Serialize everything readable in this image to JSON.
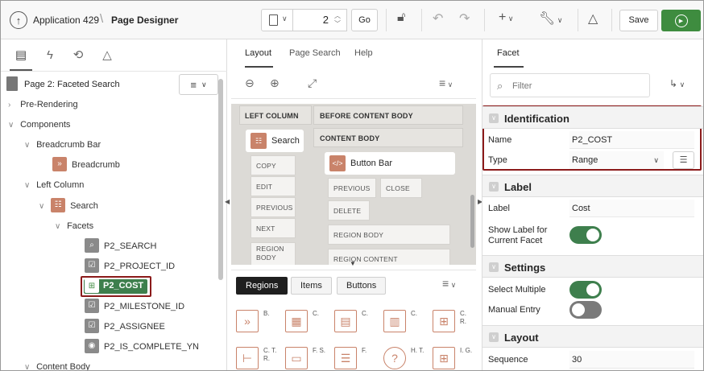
{
  "header": {
    "app_name": "Application 429",
    "page_title": "Page Designer",
    "page_number": "2",
    "go_label": "Go",
    "save_label": "Save",
    "icons": [
      "app-up-icon",
      "page-icon",
      "unlock-icon",
      "undo-icon",
      "redo-icon",
      "create-icon",
      "utilities-icon",
      "shared-components-icon",
      "run-icon"
    ]
  },
  "left_pane": {
    "tabs": [
      "rendering-tab",
      "dynamic-actions-tab",
      "processing-tab",
      "shared-components-tab"
    ],
    "page_label": "Page 2: Faceted Search",
    "tree": [
      {
        "label": "Pre-Rendering"
      },
      {
        "label": "Components"
      },
      {
        "label": "Breadcrumb Bar"
      },
      {
        "label": "Breadcrumb"
      },
      {
        "label": "Left Column"
      },
      {
        "label": "Search"
      },
      {
        "label": "Facets"
      },
      {
        "label": "P2_SEARCH"
      },
      {
        "label": "P2_PROJECT_ID"
      },
      {
        "label": "P2_COST"
      },
      {
        "label": "P2_MILESTONE_ID"
      },
      {
        "label": "P2_ASSIGNEE"
      },
      {
        "label": "P2_IS_COMPLETE_YN"
      },
      {
        "label": "Content Body"
      }
    ]
  },
  "middle_pane": {
    "tabs": [
      "Layout",
      "Page Search",
      "Help"
    ],
    "layout": {
      "left_column_header": "LEFT COLUMN",
      "before_content_header": "BEFORE CONTENT BODY",
      "content_body_header": "CONTENT BODY",
      "search_region": "Search",
      "button_bar_region": "Button Bar",
      "left_slots": [
        "COPY",
        "EDIT",
        "PREVIOUS",
        "NEXT",
        "REGION BODY"
      ],
      "content_slots": [
        "PREVIOUS",
        "CLOSE",
        "DELETE",
        "REGION BODY",
        "REGION CONTENT"
      ]
    },
    "gallery_tabs": [
      "Regions",
      "Items",
      "Buttons"
    ],
    "gallery_labels": [
      "B.",
      "C.",
      "C.",
      "C.",
      "C. R.",
      "C. T. R.",
      "F. S.",
      "F.",
      "H. T.",
      "I. G."
    ]
  },
  "right_pane": {
    "tab": "Facet",
    "filter_placeholder": "Filter",
    "sections": {
      "identification": "Identification",
      "label": "Label",
      "settings": "Settings",
      "layout": "Layout"
    },
    "props": {
      "name_label": "Name",
      "name_value": "P2_COST",
      "type_label": "Type",
      "type_value": "Range",
      "label_label": "Label",
      "label_value": "Cost",
      "show_label_label": "Show Label for Current Facet",
      "show_label_on": true,
      "select_multiple_label": "Select Multiple",
      "select_multiple_on": true,
      "manual_entry_label": "Manual Entry",
      "manual_entry_on": false,
      "sequence_label": "Sequence",
      "sequence_value": "30"
    }
  },
  "colors": {
    "accent_green": "#3e7f4d",
    "run_green": "#3e8c3f",
    "highlight_border": "#8b1a1a",
    "region_icon": "#c9836a"
  }
}
